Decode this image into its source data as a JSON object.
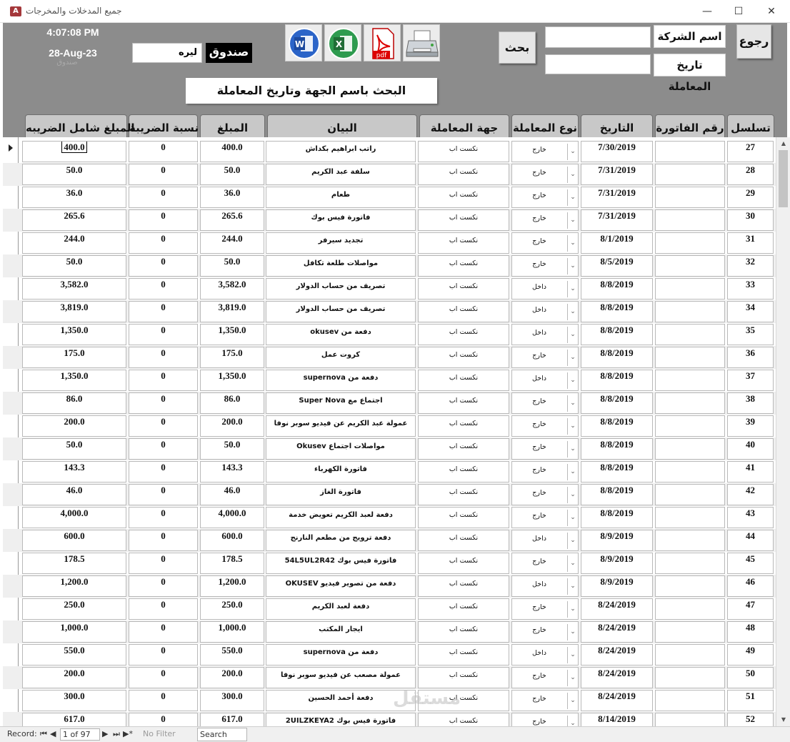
{
  "window": {
    "app_icon": "A",
    "title": "جميع المدخلات والمخرجات",
    "minimize": "—",
    "maximize": "☐",
    "close": "✕"
  },
  "header": {
    "time": "4:07:08 PM",
    "date": "28-Aug-23",
    "ghost_label": "صندوق",
    "currency_value": "ليره",
    "fund_label": "صندوق",
    "search_button": "بحث",
    "company_name_label": "اسم الشركة",
    "transaction_date_label": "تاريخ المعاملة",
    "back_button": "رجوع",
    "search_caption": "البحث باسم الجهة وتاريخ المعاملة",
    "tools": {
      "word_glyph": "W",
      "excel_glyph": "X",
      "pdf_glyph": "pdf"
    }
  },
  "columns": {
    "seq": "تسلسل",
    "invoice": "رقم الفاتورة",
    "date": "التاريخ",
    "type": "نوع المعاملة",
    "party": "جهة المعاملة",
    "description": "البيان",
    "amount": "المبلغ",
    "tax_rate": "نسبة الضريبة",
    "total": "المبلغ شامل الضريبه"
  },
  "rows": [
    {
      "seq": "27",
      "date": "7/30/2019",
      "type": "خارج",
      "party": "نكست اب",
      "desc": "راتب ابراهيم بكداش",
      "amount": "400.0",
      "rate": "0",
      "total": "400.0"
    },
    {
      "seq": "28",
      "date": "7/31/2019",
      "type": "خارج",
      "party": "نكست اب",
      "desc": "سلفة عبد الكريم",
      "amount": "50.0",
      "rate": "0",
      "total": "50.0"
    },
    {
      "seq": "29",
      "date": "7/31/2019",
      "type": "خارج",
      "party": "نكست اب",
      "desc": "طعام",
      "amount": "36.0",
      "rate": "0",
      "total": "36.0"
    },
    {
      "seq": "30",
      "date": "7/31/2019",
      "type": "خارج",
      "party": "نكست اب",
      "desc": "فاتورة فيس بوك",
      "amount": "265.6",
      "rate": "0",
      "total": "265.6"
    },
    {
      "seq": "31",
      "date": "8/1/2019",
      "type": "خارج",
      "party": "نكست اب",
      "desc": "تجديد سيرفر",
      "amount": "244.0",
      "rate": "0",
      "total": "244.0"
    },
    {
      "seq": "32",
      "date": "8/5/2019",
      "type": "خارج",
      "party": "نكست اب",
      "desc": "مواصلات طلعة تكافل",
      "amount": "50.0",
      "rate": "0",
      "total": "50.0"
    },
    {
      "seq": "33",
      "date": "8/8/2019",
      "type": "داخل",
      "party": "نكست اب",
      "desc": "تصريف من حساب الدولار",
      "amount": "3,582.0",
      "rate": "0",
      "total": "3,582.0"
    },
    {
      "seq": "34",
      "date": "8/8/2019",
      "type": "داخل",
      "party": "نكست اب",
      "desc": "تصريف من حساب الدولار",
      "amount": "3,819.0",
      "rate": "0",
      "total": "3,819.0"
    },
    {
      "seq": "35",
      "date": "8/8/2019",
      "type": "داخل",
      "party": "نكست اب",
      "desc": "دفعة من okusev",
      "amount": "1,350.0",
      "rate": "0",
      "total": "1,350.0"
    },
    {
      "seq": "36",
      "date": "8/8/2019",
      "type": "خارج",
      "party": "نكست اب",
      "desc": "كروت عمل",
      "amount": "175.0",
      "rate": "0",
      "total": "175.0"
    },
    {
      "seq": "37",
      "date": "8/8/2019",
      "type": "داخل",
      "party": "نكست اب",
      "desc": "دفعة من supernova",
      "amount": "1,350.0",
      "rate": "0",
      "total": "1,350.0"
    },
    {
      "seq": "38",
      "date": "8/8/2019",
      "type": "خارج",
      "party": "نكست اب",
      "desc": "اجتماع مع Super Nova",
      "amount": "86.0",
      "rate": "0",
      "total": "86.0"
    },
    {
      "seq": "39",
      "date": "8/8/2019",
      "type": "خارج",
      "party": "نكست اب",
      "desc": "عمولة عبد الكريم عن فيديو سوبر نوفا",
      "amount": "200.0",
      "rate": "0",
      "total": "200.0"
    },
    {
      "seq": "40",
      "date": "8/8/2019",
      "type": "خارج",
      "party": "نكست اب",
      "desc": "مواصلات اجتماع Okusev",
      "amount": "50.0",
      "rate": "0",
      "total": "50.0"
    },
    {
      "seq": "41",
      "date": "8/8/2019",
      "type": "خارج",
      "party": "نكست اب",
      "desc": "فاتورة الكهرباء",
      "amount": "143.3",
      "rate": "0",
      "total": "143.3"
    },
    {
      "seq": "42",
      "date": "8/8/2019",
      "type": "خارج",
      "party": "نكست اب",
      "desc": "فاتورة الغاز",
      "amount": "46.0",
      "rate": "0",
      "total": "46.0"
    },
    {
      "seq": "43",
      "date": "8/8/2019",
      "type": "خارج",
      "party": "نكست اب",
      "desc": "دفعة لعبد الكريم تعويض خدمة",
      "amount": "4,000.0",
      "rate": "0",
      "total": "4,000.0"
    },
    {
      "seq": "44",
      "date": "8/9/2019",
      "type": "داخل",
      "party": "نكست اب",
      "desc": "دفعة ترويج من مطعم النارنج",
      "amount": "600.0",
      "rate": "0",
      "total": "600.0"
    },
    {
      "seq": "45",
      "date": "8/9/2019",
      "type": "خارج",
      "party": "نكست اب",
      "desc": "فاتورة فيس بوك 54L5UL2R42",
      "amount": "178.5",
      "rate": "0",
      "total": "178.5"
    },
    {
      "seq": "46",
      "date": "8/9/2019",
      "type": "داخل",
      "party": "نكست اب",
      "desc": "دفعة من تصوير فيديو OKUSEV",
      "amount": "1,200.0",
      "rate": "0",
      "total": "1,200.0"
    },
    {
      "seq": "47",
      "date": "8/24/2019",
      "type": "خارج",
      "party": "نكست اب",
      "desc": "دفعة لعبد الكريم",
      "amount": "250.0",
      "rate": "0",
      "total": "250.0"
    },
    {
      "seq": "48",
      "date": "8/24/2019",
      "type": "خارج",
      "party": "نكست اب",
      "desc": "ايجار المكتب",
      "amount": "1,000.0",
      "rate": "0",
      "total": "1,000.0"
    },
    {
      "seq": "49",
      "date": "8/24/2019",
      "type": "داخل",
      "party": "نكست اب",
      "desc": "دفعة من supernova",
      "amount": "550.0",
      "rate": "0",
      "total": "550.0"
    },
    {
      "seq": "50",
      "date": "8/24/2019",
      "type": "خارج",
      "party": "نكست اب",
      "desc": "عمولة مصعب عن فيديو سوبر نوفا",
      "amount": "200.0",
      "rate": "0",
      "total": "200.0"
    },
    {
      "seq": "51",
      "date": "8/24/2019",
      "type": "خارج",
      "party": "نكست اب",
      "desc": "دفعة أحمد الحسين",
      "amount": "300.0",
      "rate": "0",
      "total": "300.0"
    },
    {
      "seq": "52",
      "date": "8/14/2019",
      "type": "خارج",
      "party": "نكست اب",
      "desc": "فاتورة فيس بوك 2UILZKEYA2",
      "amount": "617.0",
      "rate": "0",
      "total": "617.0"
    }
  ],
  "watermark": "مستقل",
  "scrollbar": {
    "up": "▲",
    "down": "▼"
  },
  "navbar": {
    "record_label": "Record:",
    "first": "⏮",
    "prev": "◀",
    "position": "1 of 97",
    "next": "▶",
    "last": "⏭",
    "new": "▶*",
    "filter_status": "No Filter",
    "search_placeholder": "Search"
  }
}
